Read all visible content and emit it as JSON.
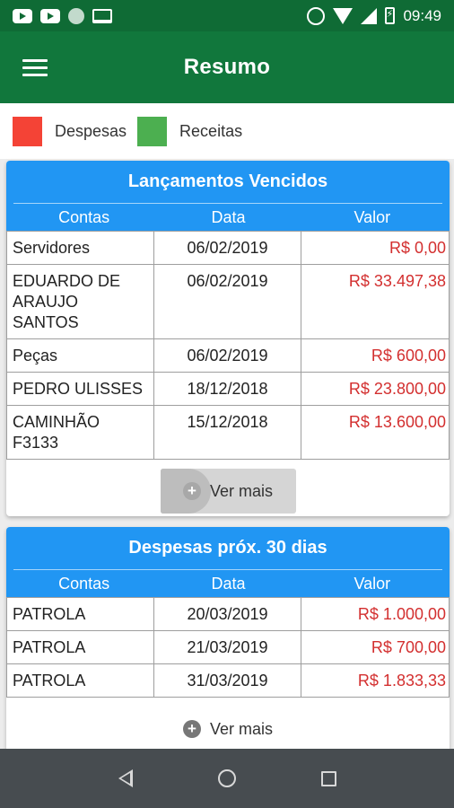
{
  "status_bar": {
    "time": "09:49",
    "icons": [
      "youtube-icon",
      "youtube-icon",
      "circle-icon",
      "laptop-icon",
      "alarm-icon",
      "wifi-icon",
      "signal-icon",
      "battery-charging-icon"
    ]
  },
  "app_bar": {
    "title": "Resumo",
    "menu_icon": "menu-icon"
  },
  "legend": {
    "items": [
      {
        "label": "Despesas",
        "color": "#f44336"
      },
      {
        "label": "Receitas",
        "color": "#4caf50"
      }
    ]
  },
  "colors": {
    "primary_dark": "#0f6b35",
    "primary": "#11773c",
    "accent": "#2196f3",
    "negative_value": "#d32f2f"
  },
  "overdue": {
    "title": "Lançamentos Vencidos",
    "columns": [
      "Contas",
      "Data",
      "Valor"
    ],
    "rows": [
      {
        "account": "Servidores",
        "date": "06/02/2019",
        "value": "R$ 0,00"
      },
      {
        "account": "EDUARDO DE ARAUJO SANTOS",
        "date": "06/02/2019",
        "value": "R$ 33.497,38"
      },
      {
        "account": "Peças",
        "date": "06/02/2019",
        "value": "R$ 600,00"
      },
      {
        "account": "PEDRO ULISSES",
        "date": "18/12/2018",
        "value": "R$ 23.800,00"
      },
      {
        "account": "CAMINHÃO F3133",
        "date": "15/12/2018",
        "value": "R$ 13.600,00"
      }
    ],
    "more_label": "Ver mais"
  },
  "upcoming": {
    "title": "Despesas próx. 30 dias",
    "columns": [
      "Contas",
      "Data",
      "Valor"
    ],
    "rows": [
      {
        "account": "PATROLA",
        "date": "20/03/2019",
        "value": "R$ 1.000,00"
      },
      {
        "account": "PATROLA",
        "date": "21/03/2019",
        "value": "R$ 700,00"
      },
      {
        "account": "PATROLA",
        "date": "31/03/2019",
        "value": "R$ 1.833,33"
      }
    ],
    "more_label": "Ver mais"
  },
  "nav_bar": {
    "icons": [
      "back-icon",
      "home-icon",
      "recent-apps-icon"
    ]
  }
}
